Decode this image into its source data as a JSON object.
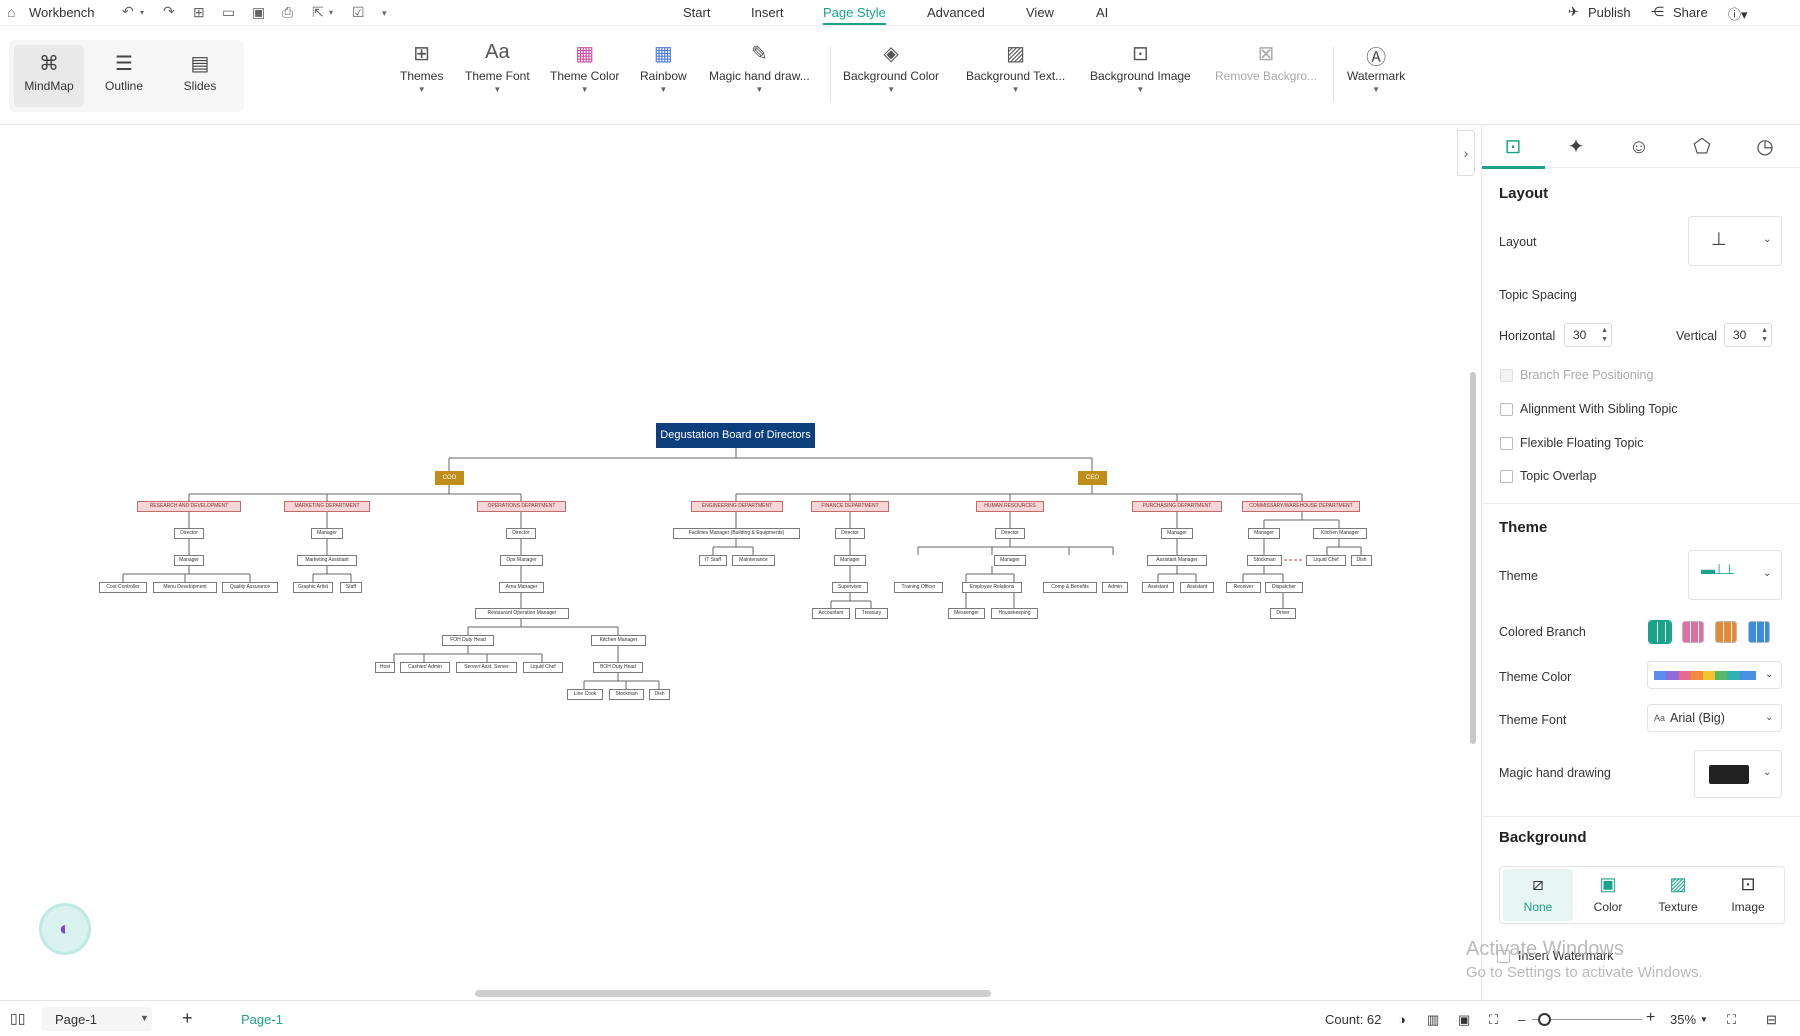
{
  "menubar": {
    "app_label": "Workbench",
    "menus": [
      "Start",
      "Insert",
      "Page Style",
      "Advanced",
      "View",
      "AI"
    ],
    "active_menu": "Page Style",
    "publish_label": "Publish",
    "share_label": "Share"
  },
  "views": {
    "mindmap": "MindMap",
    "outline": "Outline",
    "slides": "Slides"
  },
  "ribbon": {
    "themes": "Themes",
    "theme_font": "Theme Font",
    "theme_color": "Theme Color",
    "rainbow": "Rainbow",
    "magic": "Magic hand draw...",
    "bg_color": "Background Color",
    "bg_texture": "Background Text...",
    "bg_image": "Background Image",
    "remove_bg": "Remove Backgro...",
    "watermark": "Watermark"
  },
  "diagram": {
    "root": "Degustation Board of Directors",
    "coo": "COO",
    "ceo": "CEO",
    "depts": {
      "rd": "RESEARCH AND DEVELOPMENT",
      "mkt": "MARKETING DEPARTMENT",
      "ops": "OPERATIONS DEPARTMENT",
      "eng": "ENGINEERING DEPARTMENT",
      "fin": "FINANCE DEPARTMENT",
      "hr": "HUMAN RESOURCES",
      "pur": "PURCHASING DEPARTMENT",
      "com": "COMMISSARY/WAREHOUSE DEPARTMENT"
    },
    "nodes": {
      "rd_dir": "Director",
      "rd_mgr": "Manager",
      "rd_c1": "Cost Controller",
      "rd_c2": "Menu Development",
      "rd_c3": "Quality Assurance",
      "mk_mgr": "Manager",
      "mk_asst": "Marketing Assistant",
      "mk_c1": "Graphic Artist",
      "mk_c2": "Staff",
      "op_dir": "Director",
      "op_mgr": "Ops Manager",
      "op_area": "Area Manager",
      "op_rom": "Restaurant Operation Manager",
      "op_foh": "FOH Duty Head",
      "op_km": "Kitchen Manager",
      "op_h1": "Host",
      "op_h2": "Cashier/ Admin",
      "op_h3": "Server/ Asst. Server",
      "op_h4": "Liquid Chef",
      "op_boh": "BOH Duty Head",
      "op_b1": "Line Cook",
      "op_b2": "Stockman",
      "op_b3": "Dish",
      "en_fm": "Facilities Manager (Building & Equipments)",
      "en_it": "IT Staff",
      "en_mt": "Maintenance",
      "fi_dir": "Director",
      "fi_mgr": "Manager",
      "fi_sup": "Supervisor",
      "fi_acc": "Accountant",
      "fi_tre": "Treasury",
      "hr_dir": "Director",
      "hr_mgr": "Manager",
      "hr_c1": "Training Officer",
      "hr_c2": "Employee Relations",
      "hr_c3": "Comp & Benefits",
      "hr_c4": "Admin",
      "hr_g1": "Messenger",
      "hr_g2": "Housekeeping",
      "pu_mgr": "Manager",
      "pu_am": "Assistant Manager",
      "pu_a1": "Assistant",
      "pu_a2": "Assistant",
      "co_mgr": "Manager",
      "co_km": "Kitchen Manager",
      "co_stock": "Stockman",
      "co_lc": "Liquid Chef",
      "co_dish": "Dish",
      "co_rec": "Receiver",
      "co_disp": "Dispatcher",
      "co_drv": "Driver"
    }
  },
  "panel": {
    "layout_section": "Layout",
    "layout_label": "Layout",
    "topic_spacing": "Topic Spacing",
    "horizontal_label": "Horizontal",
    "horizontal_value": "30",
    "vertical_label": "Vertical",
    "vertical_value": "30",
    "branch_free": "Branch Free Positioning",
    "align_sibling": "Alignment With Sibling Topic",
    "flexible_floating": "Flexible Floating Topic",
    "topic_overlap": "Topic Overlap",
    "theme_section": "Theme",
    "theme_label": "Theme",
    "colored_branch": "Colored Branch",
    "theme_color_label": "Theme Color",
    "theme_font_label": "Theme Font",
    "theme_font_value": "Arial (Big)",
    "theme_font_prefix": "Aa",
    "magic_label": "Magic hand drawing",
    "background_section": "Background",
    "bg_none": "None",
    "bg_color": "Color",
    "bg_texture": "Texture",
    "bg_image": "Image",
    "insert_watermark": "Insert Watermark",
    "accent_color": "#1aa38a"
  },
  "statusbar": {
    "page_select": "Page-1",
    "page_tab": "Page-1",
    "count": "Count: 62",
    "zoom": "35%"
  },
  "os": {
    "activate_title": "Activate Windows",
    "activate_sub": "Go to Settings to activate Windows."
  }
}
